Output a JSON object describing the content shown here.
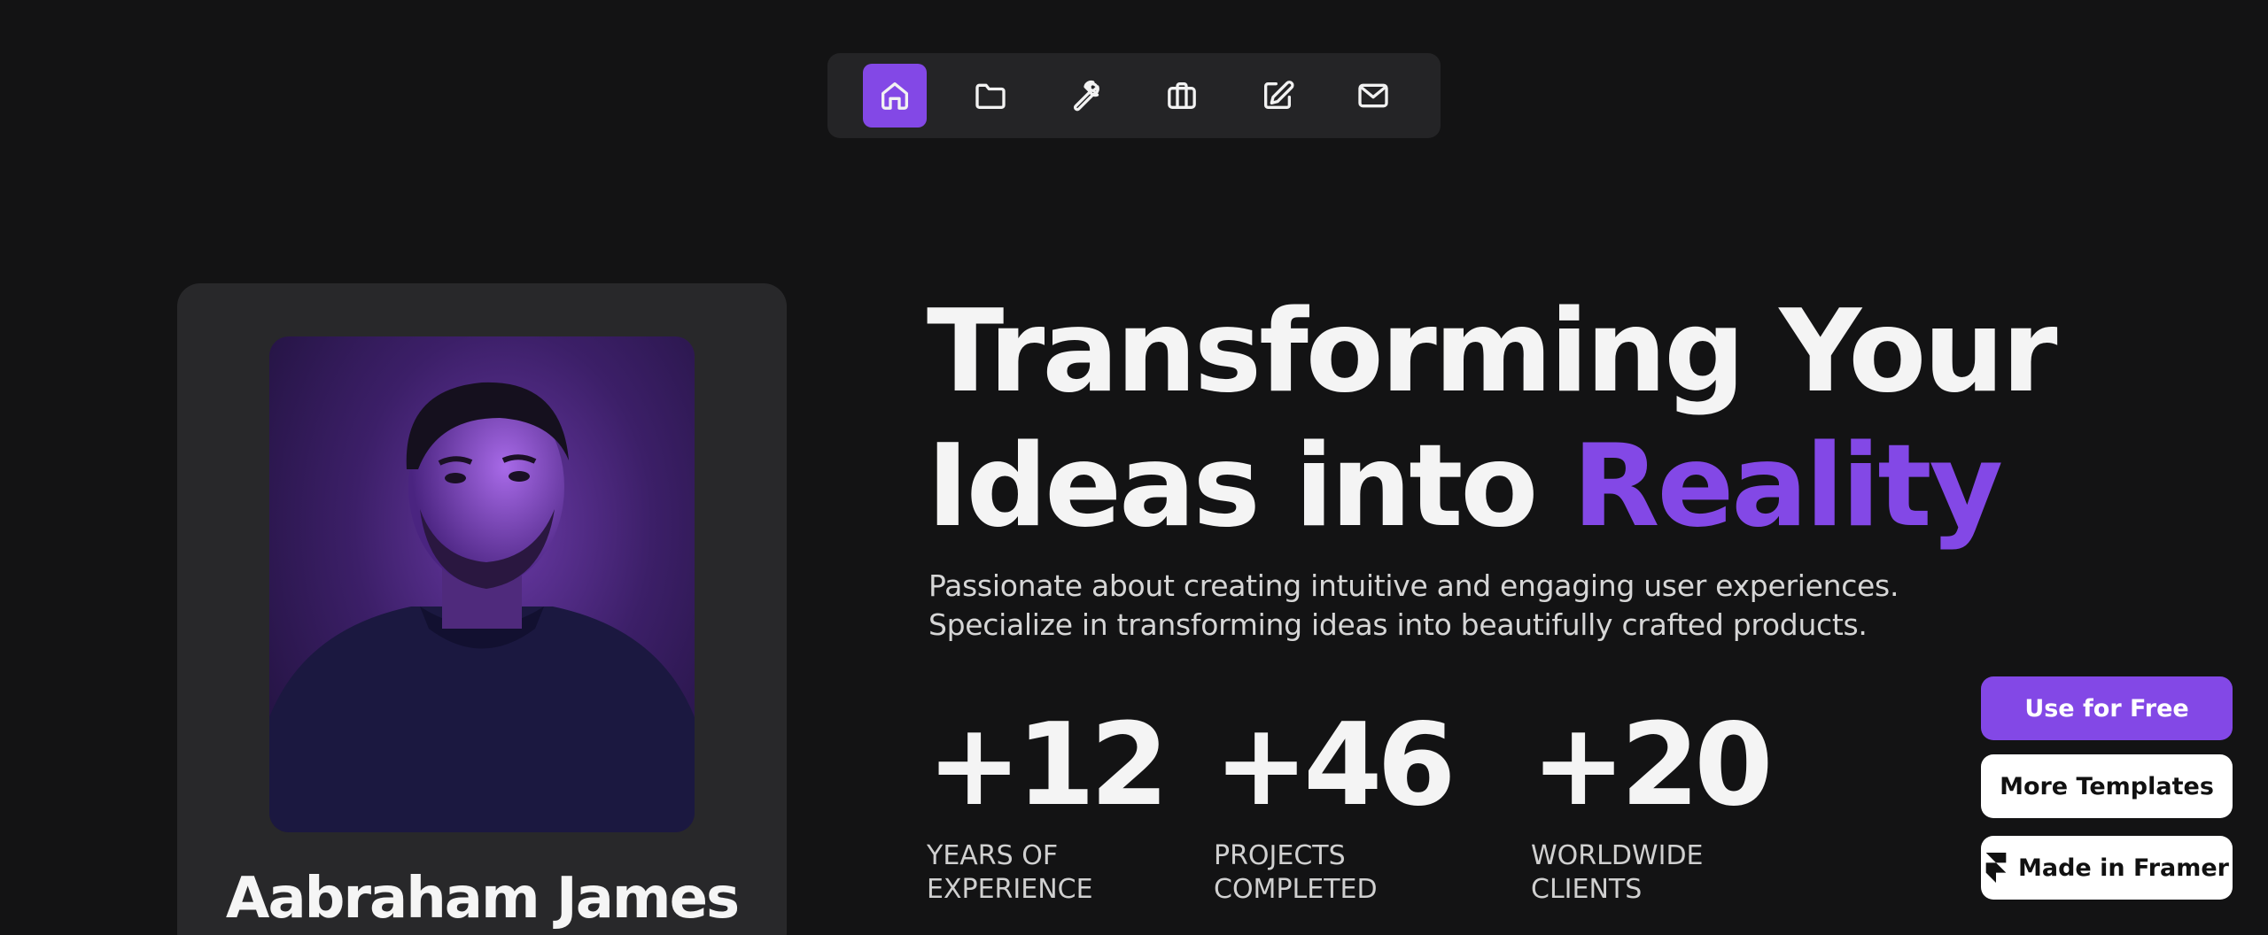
{
  "nav": {
    "items": [
      {
        "icon": "home-icon",
        "active": true
      },
      {
        "icon": "folder-icon",
        "active": false
      },
      {
        "icon": "wrench-icon",
        "active": false
      },
      {
        "icon": "briefcase-icon",
        "active": false
      },
      {
        "icon": "edit-icon",
        "active": false
      },
      {
        "icon": "mail-icon",
        "active": false
      }
    ]
  },
  "profile": {
    "name": "Aabraham James"
  },
  "hero": {
    "title_line1": "Transforming Your",
    "title_line2_prefix": "Ideas into",
    "title_line2_accent": "Reality",
    "subtitle_line1": "Passionate about creating intuitive and engaging user experiences.",
    "subtitle_line2": "Specialize in transforming ideas into beautifully crafted products."
  },
  "stats": [
    {
      "value": "+12",
      "label_line1": "Years of",
      "label_line2": "Experience"
    },
    {
      "value": "+46",
      "label_line1": "Projects",
      "label_line2": "Completed"
    },
    {
      "value": "+20",
      "label_line1": "Worldwide",
      "label_line2": "Clients"
    }
  ],
  "buttons": {
    "use_for_free": "Use for Free",
    "more_templates": "More Templates",
    "made_in_framer": "Made in Framer"
  },
  "colors": {
    "accent": "#8348e6",
    "background": "#131314",
    "card": "#28282a"
  }
}
